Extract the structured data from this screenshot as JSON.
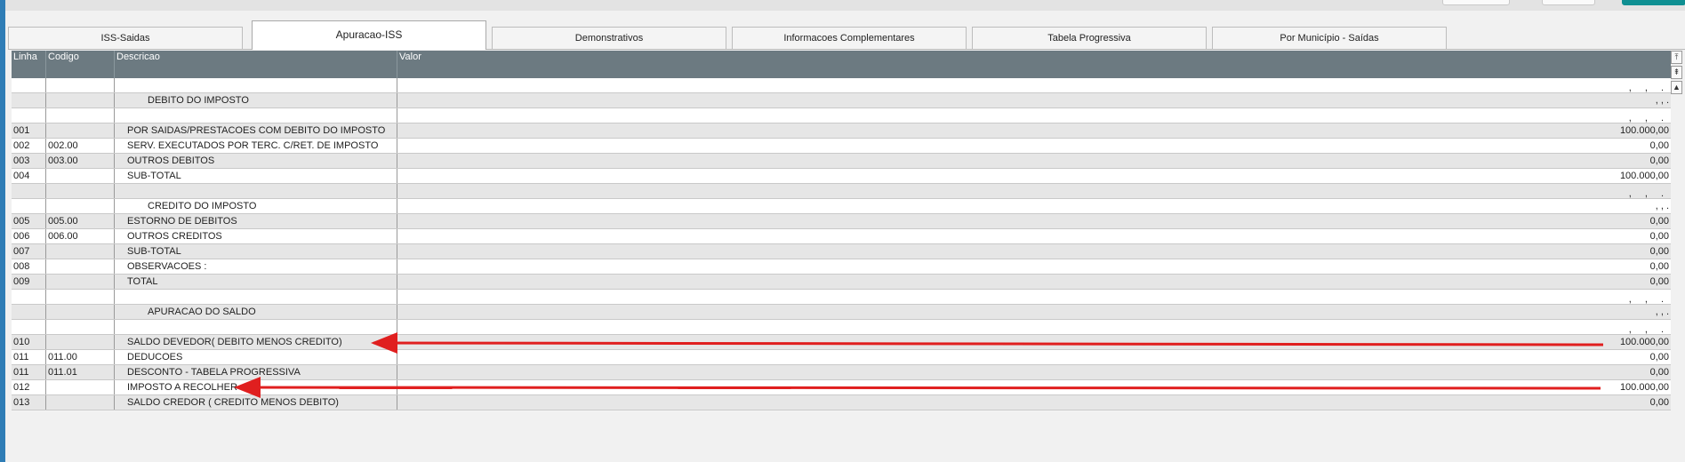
{
  "colors": {
    "header_bg": "#6c7a81",
    "arrow": "#e01f1f",
    "accent_left": "#2f7db6"
  },
  "tabs": [
    {
      "label": "ISS-Saidas"
    },
    {
      "label": "Apuracao-ISS",
      "active": true
    },
    {
      "label": "Demonstrativos"
    },
    {
      "label": "Informacoes Complementares"
    },
    {
      "label": "Tabela Progressiva"
    },
    {
      "label": "Por Município - Saídas"
    }
  ],
  "grid": {
    "columns": [
      "Linha",
      "Codigo",
      "Descricao",
      "Valor"
    ],
    "rows": [
      {
        "linha": "",
        "codigo": "",
        "descricao": "",
        "valor": ", , ."
      },
      {
        "linha": "",
        "codigo": "",
        "descricao": "DEBITO DO IMPOSTO",
        "valor": ", , ."
      },
      {
        "linha": "",
        "codigo": "",
        "descricao": "",
        "valor": ", , ."
      },
      {
        "linha": "001",
        "codigo": "",
        "descricao": "POR SAIDAS/PRESTACOES COM DEBITO DO IMPOSTO",
        "valor": "100.000,00"
      },
      {
        "linha": "002",
        "codigo": "002.00",
        "descricao": "SERV. EXECUTADOS POR TERC. C/RET. DE IMPOSTO",
        "valor": "0,00"
      },
      {
        "linha": "003",
        "codigo": "003.00",
        "descricao": "OUTROS DEBITOS",
        "valor": "0,00"
      },
      {
        "linha": "004",
        "codigo": "",
        "descricao": "SUB-TOTAL",
        "valor": "100.000,00"
      },
      {
        "linha": "",
        "codigo": "",
        "descricao": "",
        "valor": ", , ."
      },
      {
        "linha": "",
        "codigo": "",
        "descricao": "CREDITO DO IMPOSTO",
        "valor": ", , ."
      },
      {
        "linha": "005",
        "codigo": "005.00",
        "descricao": "ESTORNO DE DEBITOS",
        "valor": "0,00"
      },
      {
        "linha": "006",
        "codigo": "006.00",
        "descricao": "OUTROS CREDITOS",
        "valor": "0,00"
      },
      {
        "linha": "007",
        "codigo": "",
        "descricao": "SUB-TOTAL",
        "valor": "0,00"
      },
      {
        "linha": "008",
        "codigo": "",
        "descricao": "OBSERVACOES :",
        "valor": "0,00"
      },
      {
        "linha": "009",
        "codigo": "",
        "descricao": "TOTAL",
        "valor": "0,00"
      },
      {
        "linha": "",
        "codigo": "",
        "descricao": "",
        "valor": ", , ."
      },
      {
        "linha": "",
        "codigo": "",
        "descricao": "APURACAO DO SALDO",
        "valor": ", , ."
      },
      {
        "linha": "",
        "codigo": "",
        "descricao": "",
        "valor": ", , ."
      },
      {
        "linha": "010",
        "codigo": "",
        "descricao": "SALDO DEVEDOR( DEBITO MENOS CREDITO)",
        "valor": "100.000,00"
      },
      {
        "linha": "011",
        "codigo": "011.00",
        "descricao": "DEDUCOES",
        "valor": "0,00"
      },
      {
        "linha": "011",
        "codigo": "011.01",
        "descricao": "DESCONTO - TABELA PROGRESSIVA",
        "valor": "0,00"
      },
      {
        "linha": "012",
        "codigo": "",
        "descricao": "IMPOSTO A RECOLHER",
        "valor": "100.000,00"
      },
      {
        "linha": "013",
        "codigo": "",
        "descricao": "SALDO CREDOR ( CREDITO MENOS DEBITO)",
        "valor": "0,00"
      }
    ]
  },
  "scroll_buttons": [
    "scroll-top-icon",
    "page-up-icon",
    "line-up-icon"
  ]
}
